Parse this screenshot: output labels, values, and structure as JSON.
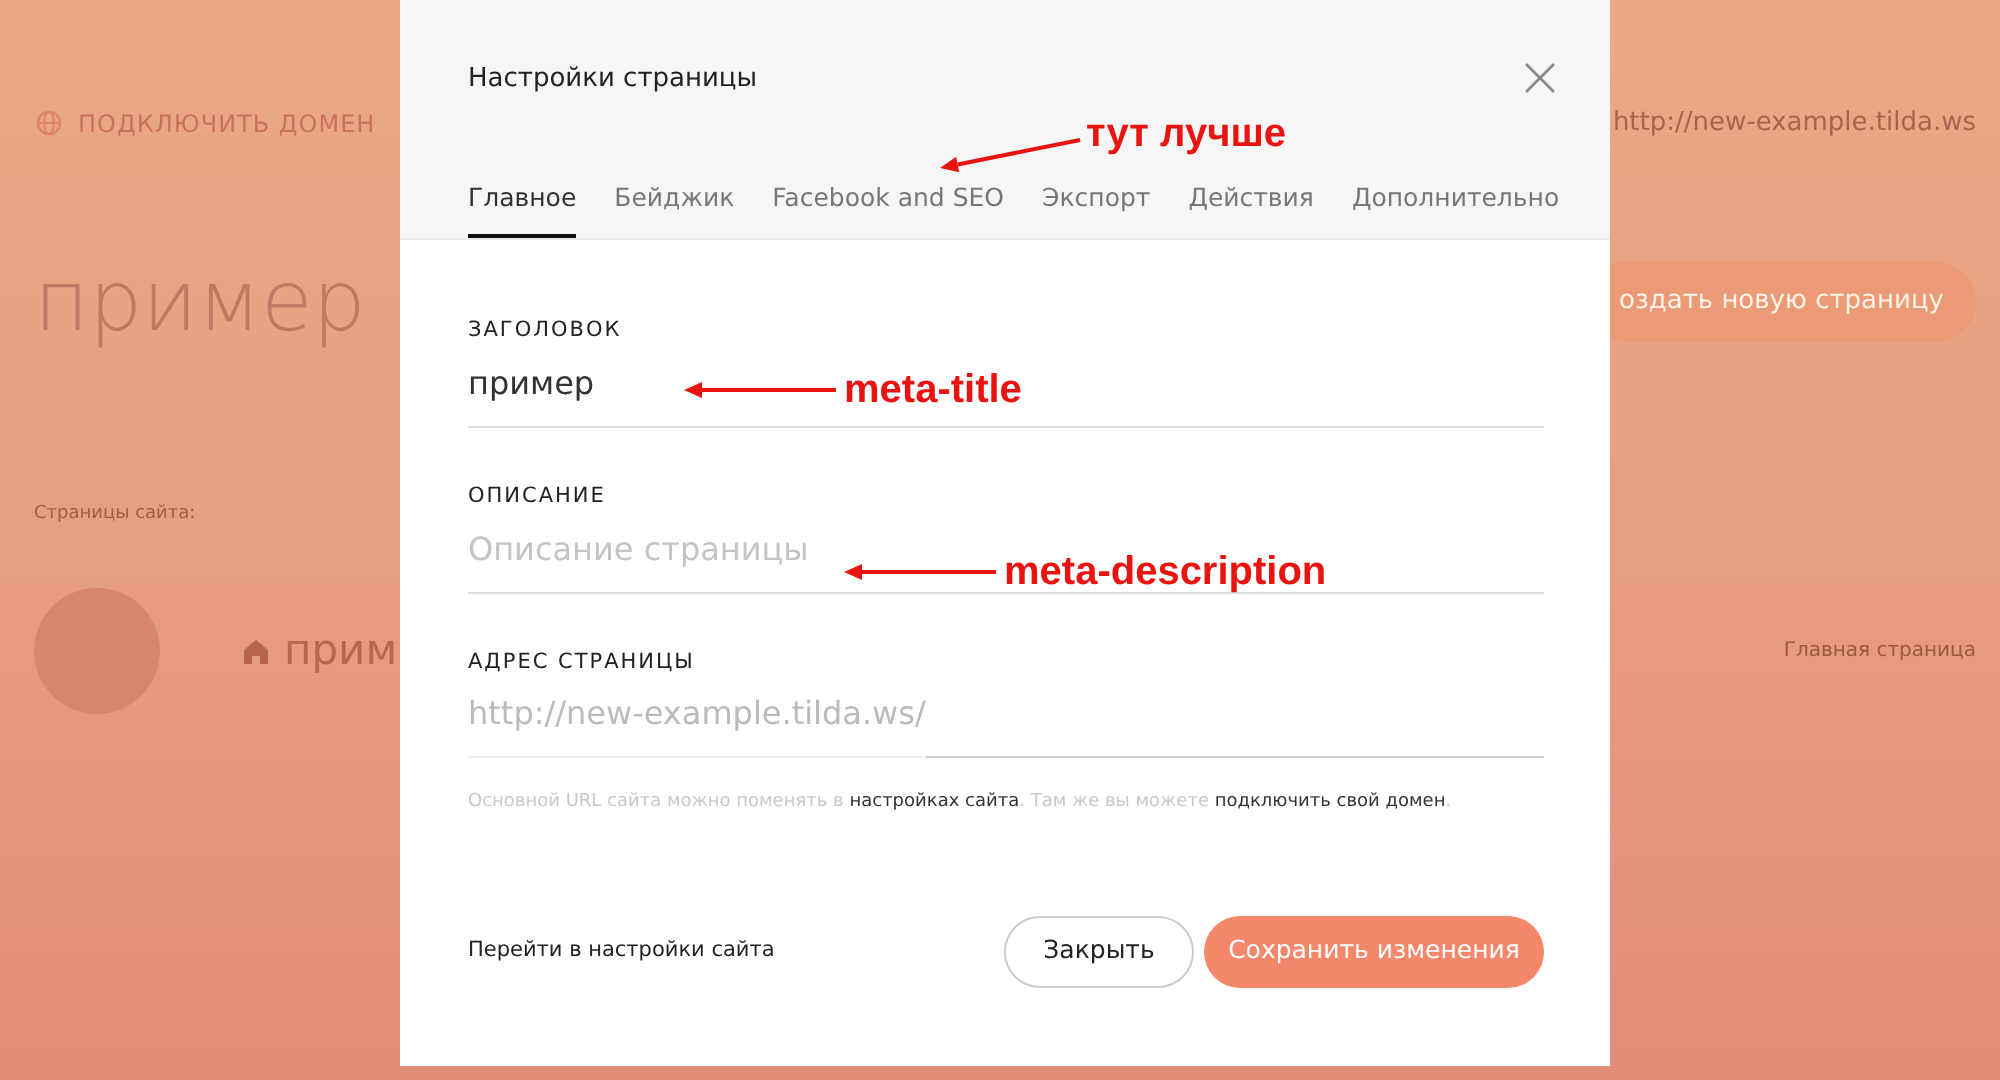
{
  "background_page": {
    "connect_domain": "ПОДКЛЮЧИТЬ ДОМЕН",
    "site_address": "http://new-example.tilda.ws",
    "site_title": "пример",
    "create_page_button": "оздать новую страницу",
    "pages_label": "Страницы сайта:",
    "pages": [
      {
        "title": "прим",
        "is_home": true,
        "tag": "Главная страница"
      }
    ]
  },
  "modal": {
    "title": "Настройки страницы",
    "tabs": [
      {
        "label": "Главное",
        "selected": true
      },
      {
        "label": "Бейджик",
        "selected": false
      },
      {
        "label": "Facebook and SEO",
        "selected": false
      },
      {
        "label": "Экспорт",
        "selected": false
      },
      {
        "label": "Действия",
        "selected": false
      },
      {
        "label": "Дополнительно",
        "selected": false
      }
    ],
    "fields": [
      {
        "kind": "text",
        "label": "ЗАГОЛОВОК",
        "value": "пример"
      },
      {
        "kind": "text",
        "label": "ОПИСАНИЕ",
        "placeholder": "Описание страницы"
      },
      {
        "kind": "url",
        "label": "АДРЕС СТРАНИЦЫ",
        "prefix": "http://new-example.tilda.ws/"
      }
    ],
    "hint": [
      {
        "text": "Основной URL сайта можно поменять в ",
        "link": false
      },
      {
        "text": "настройках сайта",
        "link": true
      },
      {
        "text": ". Там же вы можете ",
        "link": false
      },
      {
        "text": "подключить свой домен",
        "link": true
      },
      {
        "text": ".",
        "link": false
      }
    ],
    "site_settings_link": "Перейти в настройки сайта",
    "buttons": [
      {
        "label": "Закрыть",
        "kind": "secondary"
      },
      {
        "label": "Сохранить изменения",
        "kind": "primary"
      }
    ]
  },
  "annotations": [
    {
      "text": "тут лучше"
    },
    {
      "text": "meta-title"
    },
    {
      "text": "meta-description"
    }
  ]
}
